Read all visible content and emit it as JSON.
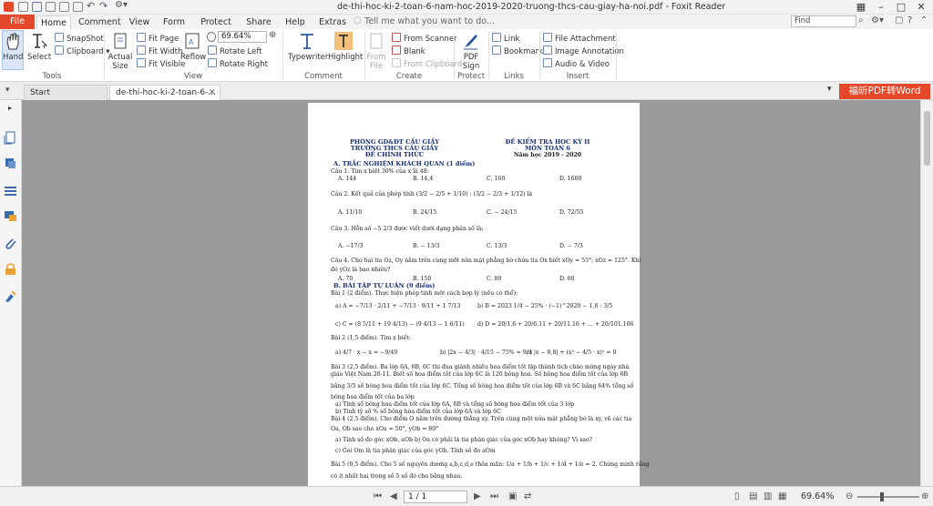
{
  "window": {
    "title": "de-thi-hoc-ki-2-toan-6-nam-hoc-2019-2020-truong-thcs-cau-giay-ha-noi.pdf - Foxit Reader"
  },
  "tabs": {
    "file": "File",
    "home": "Home",
    "comment": "Comment",
    "view": "View",
    "form": "Form",
    "protect": "Protect",
    "share": "Share",
    "help": "Help",
    "extras": "Extras",
    "tell_me": "Tell me what you want to do...",
    "find_placeholder": "Find"
  },
  "ribbon": {
    "hand": "Hand",
    "select": "Select",
    "snapshot": "SnapShot",
    "clipboard": "Clipboard",
    "actual_size": "Actual Size",
    "fit_page": "Fit Page",
    "fit_width": "Fit Width",
    "fit_visible": "Fit Visible",
    "reflow": "Reflow",
    "zoom_value": "69.64%",
    "rotate_left": "Rotate Left",
    "rotate_right": "Rotate Right",
    "typewriter": "Typewriter",
    "highlight": "Highlight",
    "from_file": "From File",
    "from_scanner": "From Scanner",
    "blank": "Blank",
    "from_clipboard": "From Clipboard",
    "pdf_sign": "PDF Sign",
    "link": "Link",
    "bookmark": "Bookmark",
    "file_attachment": "File Attachment",
    "image_annotation": "Image Annotation",
    "audio_video": "Audio & Video",
    "groups": {
      "tools": "Tools",
      "view": "View",
      "comment": "Comment",
      "create": "Create",
      "protect": "Protect",
      "links": "Links",
      "insert": "Insert"
    }
  },
  "doc_tabs": {
    "start": "Start",
    "doc": "de-thi-hoc-ki-2-toan-6-...",
    "promo": "福昕PDF转Word"
  },
  "page": {
    "hdr_left1": "PHÒNG GD&ĐT CẦU GIẤY",
    "hdr_left2": "TRƯỜNG THCS CẦU GIẤY",
    "hdr_left3": "ĐỀ CHÍNH THỨC",
    "hdr_right1": "ĐỀ KIỂM TRA HỌC KỲ II",
    "hdr_right2": "MÔN TOÁN 6",
    "hdr_right3": "Năm học 2019 - 2020",
    "secA": "A. TRẮC NGHIỆM KHÁCH QUAN (1 điểm)",
    "q1": "Câu 1. Tìm x biết 30% của x là 48:",
    "q1a": "A. 144",
    "q1b": "B. 14,4",
    "q1c": "C. 160",
    "q1d": "D. 1600",
    "q2": "Câu 2. Kết quả của phép tính (3/2 − 2/5 + 1/10) : (3/2 − 2/3 + 1/12) là",
    "q2a": "A. 11/10",
    "q2b": "B. 24/15",
    "q2c": "C. − 24/15",
    "q2d": "D. 72/55",
    "q3": "Câu 3. Hỗn số −5 2/3 được viết dưới dạng phân số là:",
    "q3a": "A. −17/3",
    "q3b": "B. − 13/3",
    "q3c": "C. 13/3",
    "q3d": "D. − 7/3",
    "q4": "Câu 4. Cho hai tia Oz, Oy nằm trên cùng một nửa mặt phẳng bờ chứa tia Ox biết xOy = 55°; xOz = 125°. Khi",
    "q4b": "đó yOz là bao nhiêu?",
    "q4a": "A. 70",
    "q4bb": "B. 150",
    "q4c": "C. 80",
    "q4d": "D. 60",
    "secB": "B. BÀI TẬP TỰ LUẬN (9 điểm)",
    "b1": "Bài 1 (2 điểm). Thực hiện phép tính một cách hợp lý (nếu có thể):",
    "b1a": "a) A = −7/13 · 2/11 + −7/13 · 9/11 + 1 7/13",
    "b1b": "b) B = 2023 1/4 − 25% · (−1)^2020 − 1,8 : 3/5",
    "b1c": "c) C = (8 5/11 + 19 4/13) − (9 4/13 − 1 6/11)",
    "b1d": "d) D = 20/1.6 + 20/6.11 + 20/11.16 + ... + 20/101.106",
    "b2": "Bài 2 (1,5 điểm). Tìm x biết:",
    "b2a": "a) 4/7 · x − x = −9/49",
    "b2b": "b) |2x − 4/3| · 4/15 − 75% = 9/4",
    "b2c": "c) |x − 0,8| + (x² − 4/5 · x)² = 0",
    "b3l1": "Bài 3 (2,5 điểm). Ba lớp 6A, 6B, 6C thi đua giành nhiều hoa điểm tốt lập thành tích chào mừng ngày nhà",
    "b3l2": "giáo Việt Nam 20-11. Biết số hoa điểm tốt của lớp 6C là 120 bông hoa. Số bông hoa điểm tốt của lớp 6B",
    "b3l3": "bằng 3/5 số bông hoa điểm tốt của lớp 6C. Tổng số bông hoa điểm tốt của lớp 6B và 6C bằng 64% tổng số",
    "b3l4": "bông hoa điểm tốt của ba lớp",
    "b3l5": "a) Tính số bông hoa điểm tốt của lớp 6A, 6B và tổng số bông hoa điểm tốt của 3 lớp",
    "b3l6": "b) Tính tỷ số % số bông hoa điểm tốt của lớp 6A và lớp 6C",
    "b4l1": "Bài 4 (2,5 điểm). Cho điểm O nằm trên đường thẳng xy. Trên cùng một nửa mặt phẳng bờ là xy, vẽ các tia",
    "b4l2": "Oa, Ob sao cho xOa = 50°, yOb = 80°",
    "b4l3": "a) Tính số đo góc xOb, aOb     b) Oa có phải là tia phân giác của góc xOb hay không? Vì sao?",
    "b4l4": "c) Gọi Om là tia phân giác của góc yOb. Tính số đo aOm",
    "b5l1": "Bài 5 (0,5 điểm). Cho 5 số nguyên dương a,b,c,d,e thỏa mãn: 1/a + 1/b + 1/c + 1/d + 1/e = 2. Chứng minh rằng",
    "b5l2": "có ít nhất hai trong số 5 số đó cho bằng nhau."
  },
  "status": {
    "page_value": "1 / 1",
    "zoom": "69.64%"
  },
  "colors": {
    "accent": "#e5472a",
    "canvas": "#999a9c",
    "header_blue": "#162f78"
  }
}
